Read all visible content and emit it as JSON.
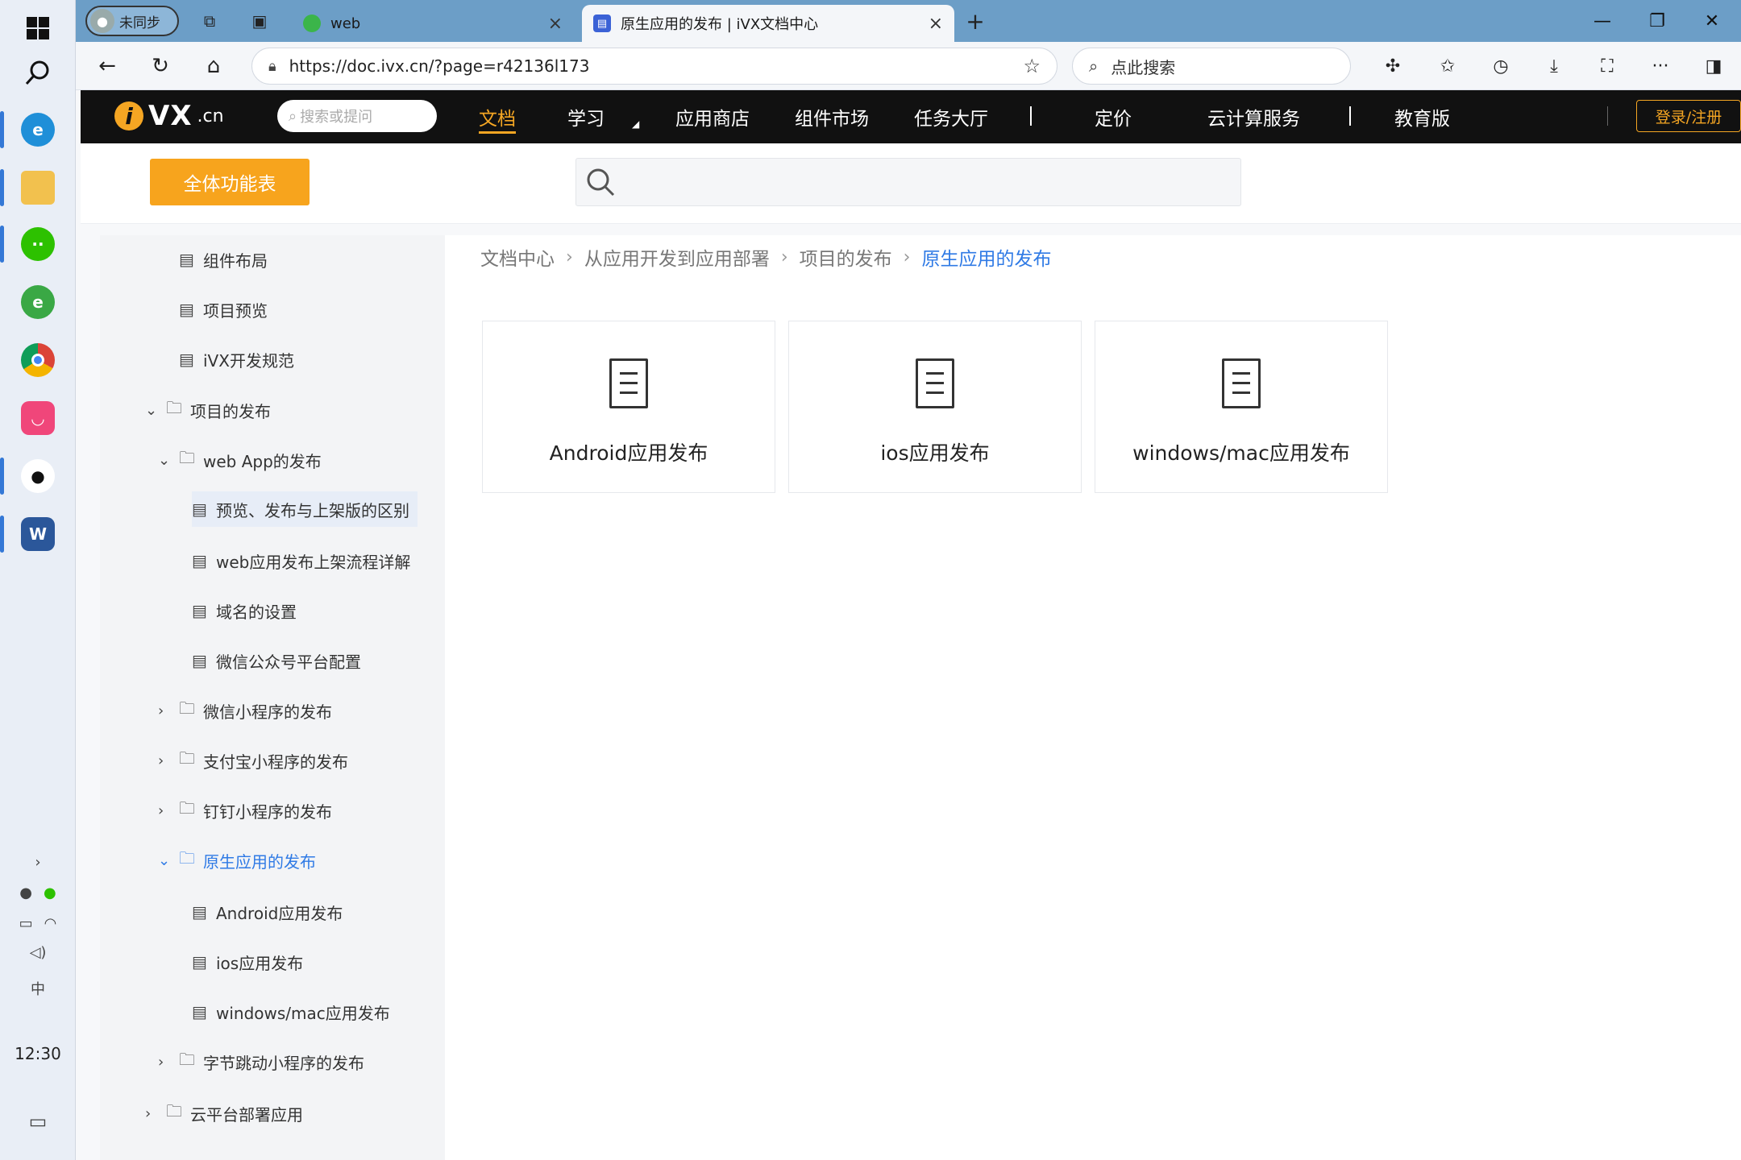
{
  "taskbar": {
    "clock": "12:30",
    "ime": "中"
  },
  "browser": {
    "profile_label": "未同步",
    "tabs": [
      {
        "title": "web",
        "active": false
      },
      {
        "title": "原生应用的发布 | iVX文档中心",
        "active": true
      }
    ],
    "address": "https://doc.ivx.cn/?page=r42136l173",
    "search_placeholder": "点此搜索"
  },
  "site": {
    "logo_vx": "VX",
    "logo_cn": ".cn",
    "search_placeholder": "搜索或提问",
    "nav": [
      "文档",
      "学习",
      "应用商店",
      "组件市场",
      "任务大厅",
      "定价",
      "云计算服务",
      "教育版"
    ],
    "login": "登录/注册",
    "all_features": "全体功能表"
  },
  "sidebar": {
    "items": [
      {
        "label": "组件布局",
        "type": "doc"
      },
      {
        "label": "项目预览",
        "type": "doc"
      },
      {
        "label": "iVX开发规范",
        "type": "doc"
      },
      {
        "label": "项目的发布",
        "type": "folder",
        "expanded": true
      },
      {
        "label": "web App的发布",
        "type": "folder",
        "expanded": true
      },
      {
        "label": "预览、发布与上架版的区别",
        "type": "doc"
      },
      {
        "label": "web应用发布上架流程详解",
        "type": "doc"
      },
      {
        "label": "域名的设置",
        "type": "doc"
      },
      {
        "label": "微信公众号平台配置",
        "type": "doc"
      },
      {
        "label": "微信小程序的发布",
        "type": "folder",
        "expanded": false
      },
      {
        "label": "支付宝小程序的发布",
        "type": "folder",
        "expanded": false
      },
      {
        "label": "钉钉小程序的发布",
        "type": "folder",
        "expanded": false
      },
      {
        "label": "原生应用的发布",
        "type": "folder",
        "expanded": true
      },
      {
        "label": "Android应用发布",
        "type": "doc"
      },
      {
        "label": "ios应用发布",
        "type": "doc"
      },
      {
        "label": "windows/mac应用发布",
        "type": "doc"
      },
      {
        "label": "字节跳动小程序的发布",
        "type": "folder",
        "expanded": false
      },
      {
        "label": "云平台部署应用",
        "type": "folder",
        "expanded": false
      }
    ]
  },
  "content": {
    "breadcrumb": [
      "文档中心",
      "从应用开发到应用部署",
      "项目的发布",
      "原生应用的发布"
    ],
    "cards": [
      "Android应用发布",
      "ios应用发布",
      "windows/mac应用发布"
    ]
  },
  "colors": {
    "accent": "#f5a623",
    "link": "#2f7ae5",
    "tabstrip": "#6c9ec7"
  }
}
